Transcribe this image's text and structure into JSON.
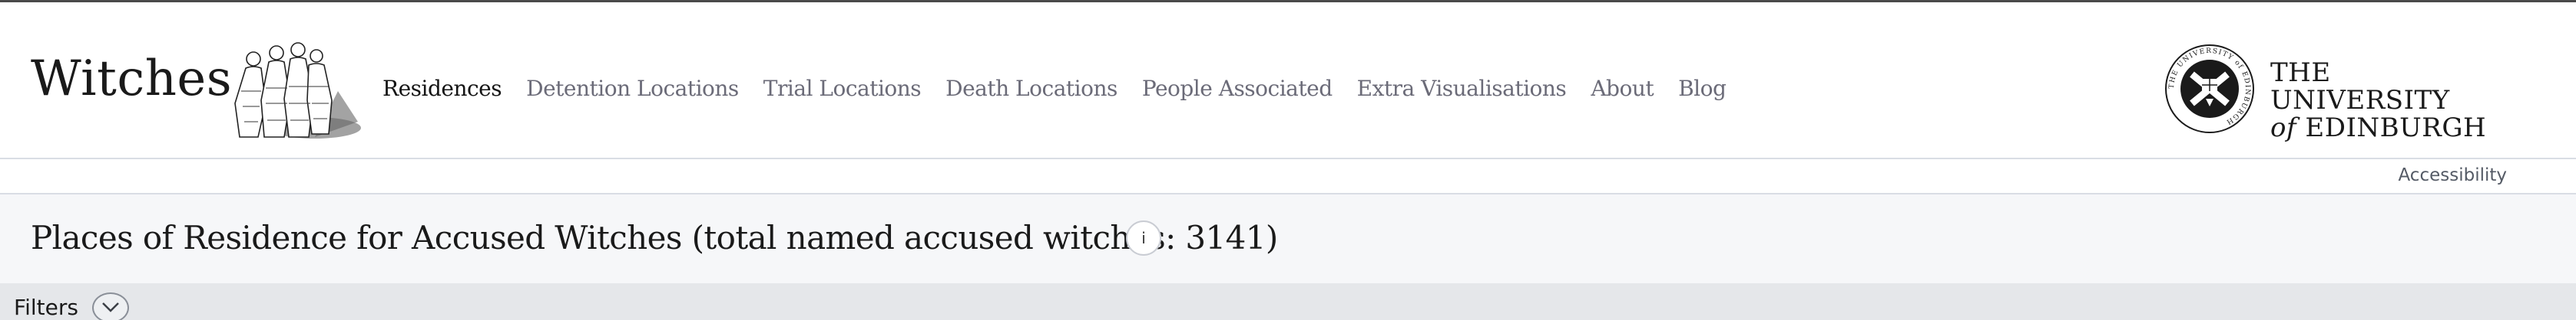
{
  "site": {
    "brand": "Witches"
  },
  "nav": {
    "items": [
      {
        "label": "Residences",
        "active": true
      },
      {
        "label": "Detention Locations",
        "active": false
      },
      {
        "label": "Trial Locations",
        "active": false
      },
      {
        "label": "Death Locations",
        "active": false
      },
      {
        "label": "People Associated",
        "active": false
      },
      {
        "label": "Extra Visualisations",
        "active": false
      },
      {
        "label": "About",
        "active": false
      },
      {
        "label": "Blog",
        "active": false
      }
    ]
  },
  "university": {
    "line1": "THE UNIVERSITY",
    "of": "of",
    "line2": "EDINBURGH",
    "crest_ring_text": "THE UNIVERSITY of EDINBURGH"
  },
  "accessibility": {
    "label": "Accessibility"
  },
  "page": {
    "title": "Places of Residence for Accused Witches (total named accused witches: 3141)",
    "info_symbol": "i"
  },
  "filters": {
    "label": "Filters",
    "toggle_icon": "chevron-down-icon"
  },
  "colors": {
    "nav_active": "#141414",
    "nav_inactive": "#6b6b78",
    "title_bar_bg": "#f6f7f9",
    "filters_bar_bg": "#e5e7ea"
  }
}
